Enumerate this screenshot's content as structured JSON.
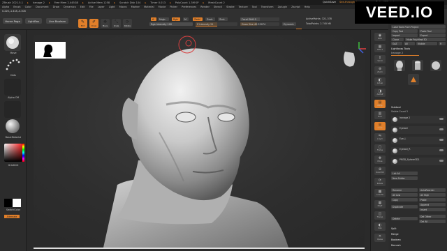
{
  "titlebar": {
    "items": [
      "ZBrush 2021.5.1",
      "Iranage 2",
      "Free Mem 2.445GB",
      "Active Mem 1258",
      "Scratch Disk 104",
      "Timer 0.013",
      "PolyCount 1.3M KP",
      "MeshCount 2"
    ],
    "quicksave": "QuickSave",
    "ui_menu": "See-through 0",
    "default_script": "DefaultZScript"
  },
  "menubar": {
    "items": [
      "Alpha",
      "Brush",
      "Color",
      "Document",
      "Draw",
      "Dynamics",
      "Edit",
      "File",
      "Layer",
      "Light",
      "Macro",
      "Marker",
      "Material",
      "Movie",
      "Picker",
      "Preferences",
      "Render",
      "Stencil",
      "Stroke",
      "Texture",
      "Tool",
      "Transform",
      "Zplugin",
      "Zscript",
      "Help"
    ],
    "status": "0.226,-1.418,-0.308"
  },
  "watermark": {
    "text": "VEED.IO"
  },
  "shelf": {
    "home_page": "Home Page",
    "lightbox": "LightBox",
    "live_boolean": "Live Boolean",
    "tools": [
      {
        "label": "Edit",
        "glyph": "✎",
        "active": true
      },
      {
        "label": "Draw",
        "glyph": "✐",
        "active": true
      },
      {
        "label": "Move",
        "glyph": "✥",
        "active": false
      },
      {
        "label": "Scale",
        "glyph": "⤡",
        "active": false
      },
      {
        "label": "Rotate",
        "glyph": "⟳",
        "active": false
      }
    ],
    "mrgb": "Mrgb",
    "rgb": "Rgb",
    "m": "M",
    "zadd": "Zadd",
    "zsub": "Zsub",
    "zcut": "Zcut",
    "rgb_intensity": {
      "label": "Rgb Intensity",
      "value": "100",
      "level": 1.0
    },
    "z_intensity": {
      "label": "Z Intensity",
      "value": "51",
      "level": 0.51
    },
    "focal_shift": {
      "label": "Focal Shift",
      "value": "0",
      "level": 0.5
    },
    "draw_size": {
      "label": "Draw Size",
      "value": "42.53074",
      "level": 0.42
    },
    "dynamic": "Dynamic",
    "active_points": "ActivePoints: 321,378",
    "total_points": "TotalPoints: 2.745 Mil"
  },
  "left_tray": {
    "brush_label": "Move",
    "stroke_label": "Dots",
    "alpha_label": "Alpha Off",
    "texture_label": "Texture Off",
    "material_label": "BasicMaterial",
    "gradient_label": "Gradient",
    "switch_color": "SwitchColor",
    "alternate": "Alternate",
    "colors": {
      "fg": "#ffffff",
      "bg": "#000000",
      "accent": "#e07f2a"
    }
  },
  "right_shelf": {
    "buttons": [
      {
        "label": "BPR",
        "glyph": "◉",
        "active": false
      },
      {
        "label": "SPix 3",
        "glyph": "▦",
        "active": false
      },
      {
        "label": "Scroll",
        "glyph": "⇕",
        "active": false
      },
      {
        "label": "Zoom",
        "glyph": "⊕",
        "active": false
      },
      {
        "label": "Actual",
        "glyph": "◧",
        "active": false
      },
      {
        "label": "AAHalf",
        "glyph": "◨",
        "active": false
      },
      {
        "label": "Persp",
        "glyph": "▤",
        "active": true
      },
      {
        "label": "Floor",
        "glyph": "▥",
        "active": false
      },
      {
        "label": "Local",
        "glyph": "◎",
        "active": true
      },
      {
        "label": "L.Sym",
        "glyph": "⇋",
        "active": false
      },
      {
        "label": "Frame",
        "glyph": "▢",
        "active": false
      },
      {
        "label": "Move",
        "glyph": "✥",
        "active": false
      },
      {
        "label": "Zoom3D",
        "glyph": "⊕",
        "active": false
      },
      {
        "label": "Rotate",
        "glyph": "⟳",
        "active": false
      },
      {
        "label": "Line Fill",
        "glyph": "▩",
        "active": false
      },
      {
        "label": "PolyF",
        "glyph": "▦",
        "active": false
      },
      {
        "label": "Transp",
        "glyph": "◫",
        "active": false
      },
      {
        "label": "Solo",
        "glyph": "◐",
        "active": false
      },
      {
        "label": "Xpose",
        "glyph": "✕",
        "active": false
      }
    ]
  },
  "right_tray": {
    "load_tools": "Load Tools From Project",
    "copy_tool": "Copy Tool",
    "paste_tool": "Paste Tool",
    "import": "Import",
    "export": "Export",
    "clone": "Clone",
    "make_polymesh": "Make PolyMesh3D",
    "goz": "GoZ",
    "all": "All",
    "visible": "Visible",
    "r": "R",
    "lightbox_tools": "Lightbox▸ Tools",
    "current_tool": "Iranage 2",
    "tool_thumbs": [
      "Iranage 2",
      "Cylinder3D",
      "PolyMesh3D",
      "SimpleBrush"
    ],
    "subtool_header": "Subtool",
    "visible_count": "Visible Count 3",
    "subtools": [
      "Iranage 2",
      "Eyeball",
      "Eye_L",
      "Eyeball_R",
      "PM3D_Sphere3D1"
    ],
    "list_all": "List All",
    "new_folder": "New Folder",
    "auto_reorder": "AutoReorder",
    "rename": "Rename",
    "all_low": "All Low",
    "all_high": "All High",
    "copy": "Copy",
    "paste": "Paste",
    "duplicate": "Duplicate",
    "append": "Append",
    "insert": "Insert",
    "delete": "Delete",
    "del_other": "Del Other",
    "del_all": "Del All",
    "split": "Split",
    "merge": "Merge",
    "boolean": "Boolean",
    "remesh": "Remesh"
  }
}
